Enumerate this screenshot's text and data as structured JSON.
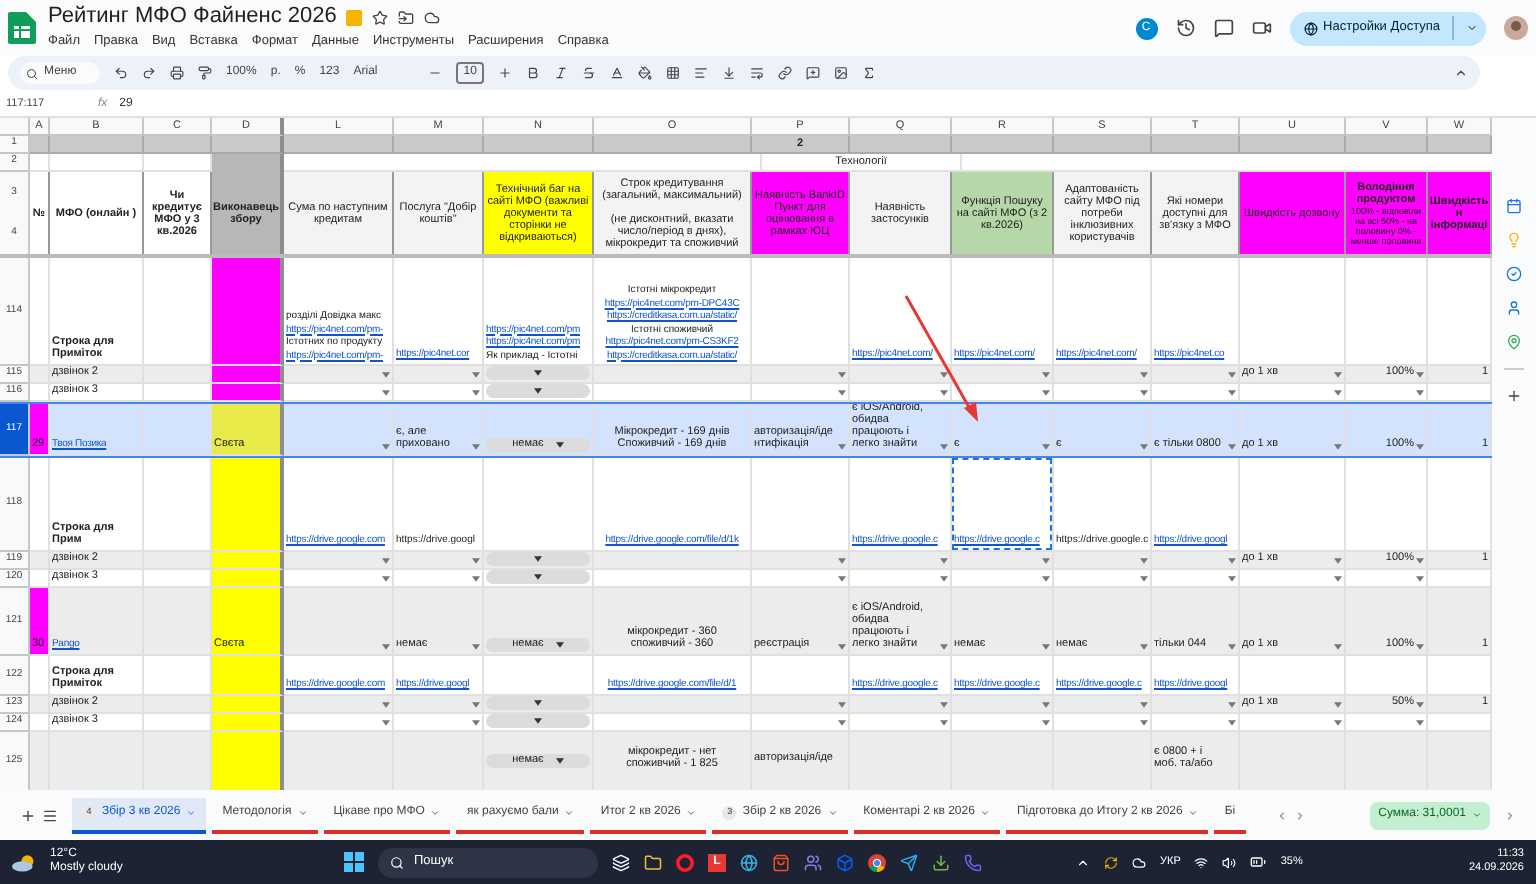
{
  "app": {
    "title": "Рейтинг МФО Файненс 2026",
    "menu": [
      "Файл",
      "Правка",
      "Вид",
      "Вставка",
      "Формат",
      "Данные",
      "Инструменты",
      "Расширения",
      "Справка"
    ],
    "account_initial": "C",
    "share_button": "Настройки Доступа"
  },
  "toolbar": {
    "search": "Меню",
    "zoom": "100%",
    "currency": "р.",
    "percent": "%",
    "number_format": "123",
    "font": "Arial",
    "font_size": "10"
  },
  "formula_bar": {
    "range": "117:117",
    "fx": "fx",
    "value": "29"
  },
  "columns": [
    "A",
    "B",
    "C",
    "D",
    "L",
    "M",
    "N",
    "O",
    "P",
    "Q",
    "R",
    "S",
    "T",
    "U",
    "V",
    "W"
  ],
  "header": {
    "row_1": {
      "number": "1",
      "marker": "2"
    },
    "row_2": {
      "number": "2",
      "group": "Технології"
    },
    "row_3_4": {
      "numbers": [
        "3",
        "4"
      ],
      "cells": [
        {
          "text": "№",
          "color": "#ffffff",
          "bold": true
        },
        {
          "text": "МФО (онлайн )",
          "color": "#ffffff",
          "bold": true
        },
        {
          "text": "Чи кредитує МФО у 3 кв.2026",
          "color": "#ffffff",
          "bold": true
        },
        {
          "text": "Виконавець збору",
          "color": "#b7b7b7",
          "bold": true
        },
        {
          "text": "Сума по наступним кредитам",
          "color": "#f3f3f3",
          "bold": false
        },
        {
          "text": "Послуга \"Добір коштів\"",
          "color": "#f3f3f3",
          "bold": false
        },
        {
          "text": "Технічний баг на сайті МФО (важливі документи та сторінки не відкриваються)",
          "color": "#ffff00",
          "bold": false
        },
        {
          "text": "Строк кредитування (загальний, максимальний)\n\n(не дисконтний, вказати число/період в днях), мікрокредит та споживчий",
          "color": "#f3f3f3",
          "bold": false
        },
        {
          "text": "Наявність BankID Пункт для оцінювання в рамках ЮЦ",
          "color": "#ff00ff",
          "bold": false
        },
        {
          "text": "Наявність застосунків",
          "color": "#f3f3f3",
          "bold": false
        },
        {
          "text": "Функція Пошуку на сайті МФО (з 2 кв.2026)",
          "color": "#b6d7a8",
          "bold": false
        },
        {
          "text": "Адаптованість сайту МФО під потреби інклюзивних користувачів",
          "color": "#f3f3f3",
          "bold": false
        },
        {
          "text": "Які номери доступні для зв'язку з МФО",
          "color": "#f3f3f3",
          "bold": false
        },
        {
          "text": "Швидкість дозвону",
          "color": "#ff00ff",
          "bold": false
        },
        {
          "text": "Володіння продуктом",
          "note": "100% - відповіли на всі 50% - на половину 0% - менше половини",
          "color": "#ff00ff",
          "bold": true
        },
        {
          "text": "Швидкість н\nінформаці",
          "color": "#ff00ff",
          "bold": true
        }
      ]
    }
  },
  "rows": [
    {
      "number": "114",
      "selected": false,
      "shaded": false,
      "cells": [
        {},
        {
          "text": "Строка для\nПриміток",
          "bold": true
        },
        {},
        {
          "color": "#ff00ff"
        },
        {
          "lines": [
            {
              "text": "розділі Довідка макс",
              "link": false
            },
            {
              "text": "https://pic4net.com/pm-",
              "link": true
            },
            {
              "text": "Істотних по продукту",
              "link": false
            },
            {
              "text": "https://pic4net.com/pm-",
              "link": true
            }
          ]
        },
        {
          "text": "https://pic4net.cor",
          "link": true
        },
        {
          "lines": [
            {
              "text": "https://pic4net.com/pm",
              "link": true
            },
            {
              "text": "https://pic4net.com/pm",
              "link": true
            },
            {
              "text": "Як приклад - Істотні",
              "link": false
            }
          ]
        },
        {
          "lines": [
            {
              "text": "Істотні мікрокредит",
              "link": false
            },
            {
              "text": "https://pic4net.com/pm-DPC43C",
              "link": true
            },
            {
              "text": "https://creditkasa.com.ua/static/",
              "link": true
            },
            {
              "text": "Істотні споживчий",
              "link": false
            },
            {
              "text": "https://pic4net.com/pm-CS3KF2",
              "link": true
            },
            {
              "text": "https://creditkasa.com.ua/static/",
              "link": true
            }
          ]
        },
        {},
        {
          "text": "https://pic4net.com/",
          "link": true
        },
        {
          "text": "https://pic4net.com/",
          "link": true
        },
        {
          "text": "https://pic4net.com/",
          "link": true
        },
        {
          "text": "https://pic4net.co",
          "link": true
        },
        {},
        {},
        {}
      ]
    },
    {
      "number": "115",
      "selected": false,
      "shaded": true,
      "cells": [
        {},
        {
          "text": "дзвінок 2"
        },
        {},
        {
          "color": "#ff00ff"
        },
        {
          "dropdown": true
        },
        {
          "dropdown": true
        },
        {
          "chip": true
        },
        {},
        {
          "dropdown": true
        },
        {
          "dropdown": true
        },
        {
          "dropdown": true
        },
        {
          "dropdown": true
        },
        {
          "dropdown": true
        },
        {
          "text": "до 1 хв",
          "dropdown": true
        },
        {
          "text": "100%",
          "dropdown": true
        },
        {
          "text": "1"
        }
      ]
    },
    {
      "number": "116",
      "selected": false,
      "shaded": false,
      "cells": [
        {},
        {
          "text": "дзвінок 3"
        },
        {},
        {
          "color": "#ff00ff"
        },
        {
          "dropdown": true
        },
        {
          "dropdown": true
        },
        {
          "chip": true
        },
        {},
        {
          "dropdown": true
        },
        {
          "dropdown": true
        },
        {
          "dropdown": true
        },
        {
          "dropdown": true
        },
        {
          "dropdown": true
        },
        {
          "dropdown": true
        },
        {
          "dropdown": true
        },
        {}
      ]
    },
    {
      "number": "117",
      "selected": true,
      "shaded": false,
      "cells": [
        {
          "text": "29",
          "color": "#ff00ff"
        },
        {
          "text": "Твоя Позика",
          "link": true
        },
        {},
        {
          "text": "Свєта",
          "color": "#e8ea4a"
        },
        {
          "dropdown": true
        },
        {
          "text": "є, але\nприховано",
          "dropdown": true
        },
        {
          "text": "немає",
          "chip": true
        },
        {
          "text": "Мікрокредит - 169 днів\nСпоживчий - 169 днів"
        },
        {
          "text": "авторизація/іде\nнтифікація",
          "dropdown": true
        },
        {
          "text": "є iOS/Android,\nобидва\nпрацюють і\nлегко знайти",
          "dropdown": true
        },
        {
          "text": "є",
          "dropdown": true
        },
        {
          "text": "є",
          "dropdown": true
        },
        {
          "text": "є тільки 0800",
          "dropdown": true
        },
        {
          "text": "до 1 хв",
          "dropdown": true
        },
        {
          "text": "100%",
          "dropdown": true
        },
        {
          "text": "1"
        }
      ]
    },
    {
      "number": "118",
      "selected": false,
      "shaded": false,
      "cells": [
        {},
        {
          "text": "Строка для Прим",
          "bold": true
        },
        {},
        {
          "color": "#ffff00"
        },
        {
          "text": "https://drive.google.com",
          "link": true
        },
        {
          "text": "https://drive.googl"
        },
        {},
        {
          "text": "https://drive.google.com/file/d/1k",
          "link": true
        },
        {},
        {
          "text": "https://drive.google.c",
          "link": true
        },
        {
          "text": "https://drive.google.c",
          "link": true,
          "marquee": true
        },
        {
          "text": "https://drive.google.c"
        },
        {
          "text": "https://drive.googl",
          "link": true
        },
        {},
        {},
        {}
      ]
    },
    {
      "number": "119",
      "selected": false,
      "shaded": true,
      "cells": [
        {},
        {
          "text": "дзвінок 2"
        },
        {},
        {
          "color": "#ffff00"
        },
        {
          "dropdown": true
        },
        {
          "dropdown": true
        },
        {
          "chip": true
        },
        {},
        {
          "dropdown": true
        },
        {
          "dropdown": true
        },
        {
          "dropdown": true
        },
        {
          "dropdown": true
        },
        {
          "dropdown": true
        },
        {
          "text": "до 1 хв",
          "dropdown": true
        },
        {
          "text": "100%",
          "dropdown": true
        },
        {
          "text": "1"
        }
      ]
    },
    {
      "number": "120",
      "selected": false,
      "shaded": false,
      "cells": [
        {},
        {
          "text": "дзвінок 3"
        },
        {},
        {
          "color": "#ffff00"
        },
        {
          "dropdown": true
        },
        {
          "dropdown": true
        },
        {
          "chip": true
        },
        {},
        {
          "dropdown": true
        },
        {
          "dropdown": true
        },
        {
          "dropdown": true
        },
        {
          "dropdown": true
        },
        {
          "dropdown": true
        },
        {
          "dropdown": true
        },
        {
          "dropdown": true
        },
        {}
      ]
    },
    {
      "number": "121",
      "selected": false,
      "shaded": true,
      "cells": [
        {
          "text": "30",
          "color": "#ff00ff"
        },
        {
          "text": "Pango",
          "link": true
        },
        {},
        {
          "text": "Свєта",
          "color": "#ffff00"
        },
        {
          "dropdown": true
        },
        {
          "text": "немає",
          "dropdown": true
        },
        {
          "text": "немає",
          "chip": true
        },
        {
          "text": "мікрокредит - 360\nспоживчий - 360"
        },
        {
          "text": "реєстрація",
          "dropdown": true
        },
        {
          "text": "є iOS/Android,\nобидва\nпрацюють і\nлегко знайти",
          "dropdown": true
        },
        {
          "text": "немає",
          "dropdown": true
        },
        {
          "text": "немає",
          "dropdown": true
        },
        {
          "text": "тільки 044",
          "dropdown": true
        },
        {
          "text": "до 1 хв",
          "dropdown": true
        },
        {
          "text": "100%",
          "dropdown": true
        },
        {
          "text": "1"
        }
      ]
    },
    {
      "number": "122",
      "selected": false,
      "shaded": false,
      "cells": [
        {},
        {
          "text": "Строка для\nПриміток",
          "bold": true
        },
        {},
        {
          "color": "#ffff00"
        },
        {
          "text": "https://drive.google.com",
          "link": true
        },
        {
          "text": "https://drive.googl",
          "link": true
        },
        {},
        {
          "text": "https://drive.google.com/file/d/1",
          "link": true
        },
        {},
        {
          "text": "https://drive.google.c",
          "link": true
        },
        {
          "text": "https://drive.google.c",
          "link": true
        },
        {
          "text": "https://drive.google.c",
          "link": true
        },
        {
          "text": "https://drive.googl",
          "link": true
        },
        {},
        {},
        {}
      ]
    },
    {
      "number": "123",
      "selected": false,
      "shaded": true,
      "cells": [
        {},
        {
          "text": "дзвінок 2"
        },
        {},
        {
          "color": "#ffff00"
        },
        {
          "dropdown": true
        },
        {
          "dropdown": true
        },
        {
          "chip": true
        },
        {},
        {
          "dropdown": true
        },
        {
          "dropdown": true
        },
        {
          "dropdown": true
        },
        {
          "dropdown": true
        },
        {
          "dropdown": true
        },
        {
          "text": "до 1 хв",
          "dropdown": true
        },
        {
          "text": "50%",
          "dropdown": true
        },
        {
          "text": "1"
        }
      ]
    },
    {
      "number": "124",
      "selected": false,
      "shaded": false,
      "cells": [
        {},
        {
          "text": "дзвінок 3"
        },
        {},
        {
          "color": "#ffff00"
        },
        {
          "dropdown": true
        },
        {
          "dropdown": true
        },
        {
          "chip": true
        },
        {},
        {
          "dropdown": true
        },
        {
          "dropdown": true
        },
        {
          "dropdown": true
        },
        {
          "dropdown": true
        },
        {
          "dropdown": true
        },
        {
          "dropdown": true
        },
        {
          "dropdown": true
        },
        {}
      ]
    },
    {
      "number": "125",
      "selected": false,
      "shaded": true,
      "cells": [
        {},
        {},
        {},
        {
          "color": "#ffff00"
        },
        {},
        {},
        {
          "text": "немає",
          "chip": true
        },
        {
          "text": "мікрокредит - нет\nспоживчий - 1 825"
        },
        {
          "text": "авторизація/іде"
        },
        {},
        {},
        {},
        {
          "text": "є 0800 + і\nмоб. та/або"
        },
        {},
        {},
        {}
      ]
    }
  ],
  "sheet_tabs": {
    "items": [
      {
        "label": "Збір 3 кв 2026",
        "badge": "4",
        "selected": true
      },
      {
        "label": "Методологія",
        "selected": false
      },
      {
        "label": "Цікаве про МФО",
        "selected": false
      },
      {
        "label": "як рахуємо бали",
        "selected": false
      },
      {
        "label": "Итог 2 кв 2026",
        "selected": false
      },
      {
        "label": "Збір 2 кв 2026",
        "badge": "3",
        "selected": false
      },
      {
        "label": "Коментарі 2 кв 2026",
        "selected": false
      },
      {
        "label": "Підготовка до Итогу 2 кв 2026",
        "selected": false
      },
      {
        "label": "Бі",
        "selected": false
      }
    ],
    "sum": "Сумма: 31,0001"
  },
  "taskbar": {
    "weather_temp": "12°C",
    "weather_text": "Mostly cloudy",
    "search": "Пошук",
    "app_letter": "L",
    "language": "УКР",
    "battery": "35%",
    "time": "11:33",
    "date": "24.09.2026"
  }
}
